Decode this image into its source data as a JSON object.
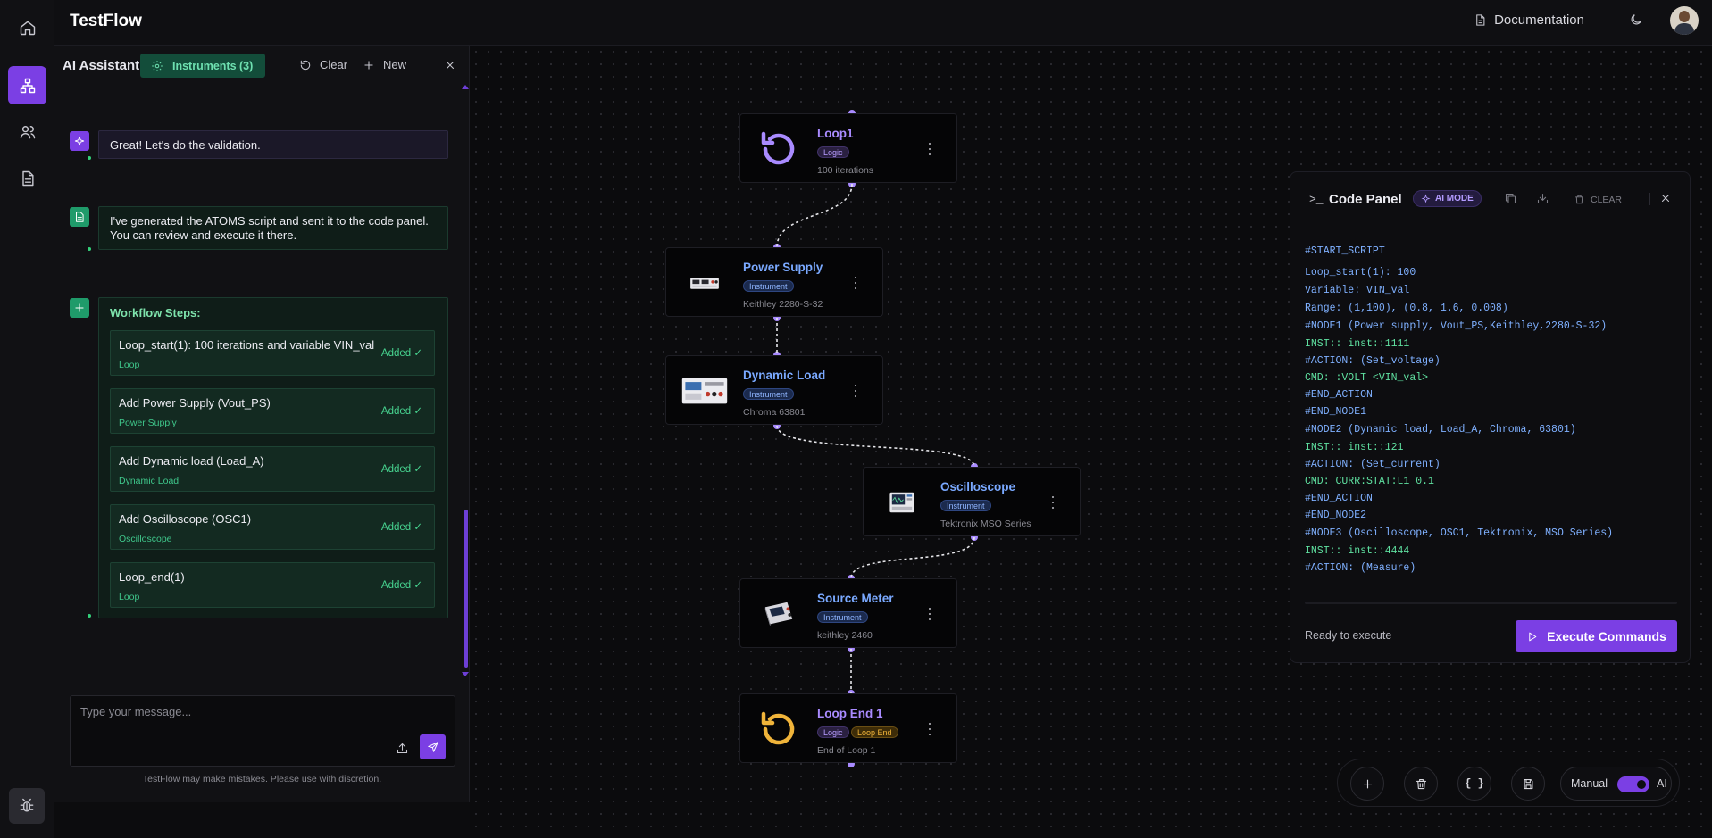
{
  "app": {
    "name": "TestFlow"
  },
  "topbar": {
    "documentation_label": "Documentation"
  },
  "chat": {
    "title": "AI Assistant",
    "instruments_label": "Instruments (3)",
    "clear_label": "Clear",
    "new_label": "New",
    "messages": [
      {
        "text": "Great! Let's do the validation."
      },
      {
        "text": "I've generated the ATOMS script and sent it to the code panel. You can review and execute it there."
      }
    ],
    "workflow": {
      "title": "Workflow Steps:",
      "steps": [
        {
          "title": "Loop_start(1): 100 iterations and variable VIN_val",
          "type": "Loop",
          "status": "Added ✓"
        },
        {
          "title": "Add Power Supply (Vout_PS)",
          "type": "Power Supply",
          "status": "Added ✓"
        },
        {
          "title": "Add Dynamic load (Load_A)",
          "type": "Dynamic Load",
          "status": "Added ✓"
        },
        {
          "title": "Add Oscilloscope (OSC1)",
          "type": "Oscilloscope",
          "status": "Added ✓"
        },
        {
          "title": "Loop_end(1)",
          "type": "Loop",
          "status": "Added ✓"
        }
      ]
    },
    "input_placeholder": "Type your message...",
    "disclaimer": "TestFlow may make mistakes. Please use with discretion."
  },
  "nodes": {
    "loop1": {
      "title": "Loop1",
      "tag": "Logic",
      "sub": "100 iterations"
    },
    "power_supply": {
      "title": "Power Supply",
      "tag": "Instrument",
      "sub": "Keithley 2280-S-32"
    },
    "dynamic_load": {
      "title": "Dynamic Load",
      "tag": "Instrument",
      "sub": "Chroma 63801"
    },
    "oscilloscope": {
      "title": "Oscilloscope",
      "tag": "Instrument",
      "sub": "Tektronix MSO Series"
    },
    "source_meter": {
      "title": "Source Meter",
      "tag": "Instrument",
      "sub": "keithley 2460"
    },
    "loop_end": {
      "title": "Loop End 1",
      "tag": "Logic",
      "tag2": "Loop End",
      "sub": "End of Loop 1"
    }
  },
  "code_panel": {
    "prompt": ">_",
    "title": "Code Panel",
    "mode_label": "AI MODE",
    "clear_label": "CLEAR",
    "lines": [
      "#START_SCRIPT",
      "Loop_start(1): 100",
      "Variable: VIN_val",
      "Range: (1,100), (0.8, 1.6, 0.008)",
      "#NODE1 (Power supply, Vout_PS,Keithley,2280-S-32)",
      "INST:: inst::1111",
      "#ACTION: (Set_voltage)",
      "CMD: :VOLT <VIN_val>",
      "#END_ACTION",
      "#END_NODE1",
      "#NODE2 (Dynamic load, Load_A, Chroma, 63801)",
      "INST:: inst::121",
      "#ACTION: (Set_current)",
      "CMD: CURR:STAT:L1 0.1",
      "#END_ACTION",
      "#END_NODE2",
      "#NODE3 (Oscilloscope, OSC1, Tektronix, MSO Series)",
      "INST:: inst::4444",
      "#ACTION: (Measure)"
    ],
    "status": "Ready to execute",
    "execute_label": "Execute Commands"
  },
  "toolbar": {
    "json_label": "{ }",
    "manual_label": "Manual",
    "ai_label": "AI",
    "ai_enabled": true
  },
  "colors": {
    "accent": "#7b3fe4",
    "success": "#47d490",
    "node_link": "#a98bff"
  }
}
